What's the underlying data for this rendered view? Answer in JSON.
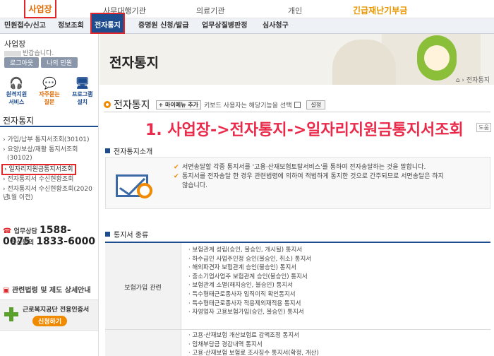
{
  "topnav": {
    "business": "사업장",
    "items": [
      "사무대행기관",
      "의료기관",
      "개인"
    ],
    "emergency": "긴급재난기부금"
  },
  "menubar": {
    "items": [
      "민원접수/신고",
      "정보조회",
      "전자통지",
      "증명원 신청/발급",
      "업무상질병판정",
      "심사청구"
    ],
    "active_index": 2
  },
  "sidebar": {
    "user": "사업장",
    "greeting": "반갑습니다.",
    "logout": "로그아웃",
    "my_minwon": "나의 민원",
    "icons": [
      {
        "label1": "원격지원",
        "label2": "서비스",
        "icon": "headset-icon"
      },
      {
        "label1": "자주묻는",
        "label2": "질문",
        "icon": "chat-icon"
      },
      {
        "label1": "프로그램",
        "label2": "설치",
        "icon": "monitor-icon"
      }
    ],
    "section_title": "전자통지",
    "items": [
      {
        "label": "› 가입/납부 통지서조회(30101)"
      },
      {
        "label": "› 요양/보상/재활 통지서조회"
      },
      {
        "label": "(30102)"
      },
      {
        "label": "› 일자리지원금통지서조회"
      },
      {
        "label": "› 전자통지서 수신현황조회"
      },
      {
        "label": "› 전자통지서 수신현황조회(2020년"
      },
      {
        "label": "1월 이전)"
      }
    ],
    "selected_index": 3,
    "phone1_label": "업무상담",
    "phone1": "1588-0075",
    "phone2_label": "전산문의",
    "phone2": "1833-6000",
    "law": "관련법령 및 제도 상세안내",
    "cert_title": "근로복지공단 전용인증서",
    "cert_button": "신청하기"
  },
  "main": {
    "banner_title": "전자통지",
    "breadcrumb": "⌂ › 전자통지",
    "page_title": "전자통지",
    "my_menu": "+ 마이메뉴 추가",
    "keyboard": "키보드 사용자는 해당기능을 선택",
    "set_button": "설정",
    "help": "도움",
    "overlay": "1. 사업장->전자통지->일자리지원금통지서조회",
    "intro_title": "전자통지소개",
    "intro_lines": [
      "서면송달할 각종 통지서를 '고용·산재보험토탈서비스'를 통하여 전자송달하는 것을 말합니다.",
      "통지서를 전자송달 한 경우 관련법령에 의하여 적법하게 통지한 것으로 간주되므로 서면송달은 하지",
      "않습니다."
    ],
    "types_title": "통지서 종류",
    "category1": "보험가입 관련",
    "list1": [
      "보험관계 성립(승인, 불승인, 개시될) 통지서",
      "하수급인 사업주인정 승인(불승인, 취소) 통지서",
      "해외파견자 보험관계 승인(불승인) 통지서",
      "중소기업사업주 보험관계 승인(불승인) 통지서",
      "보험관계 소멸(해지승인, 불승인) 통지서",
      "특수형태근로종사자 입직이직 확인통지서",
      "특수형태근로종사자 적용제외재적용 통지서",
      "자영업자 고용보험가입(승인, 불승인) 통지서"
    ],
    "list2": [
      "고용·산재보험 개산보험료 감액조정 통지서",
      "임채부담금 경감내역 통지서",
      "고용·산재보험 보험료 조사징수 통지서(확정, 개산)"
    ]
  }
}
